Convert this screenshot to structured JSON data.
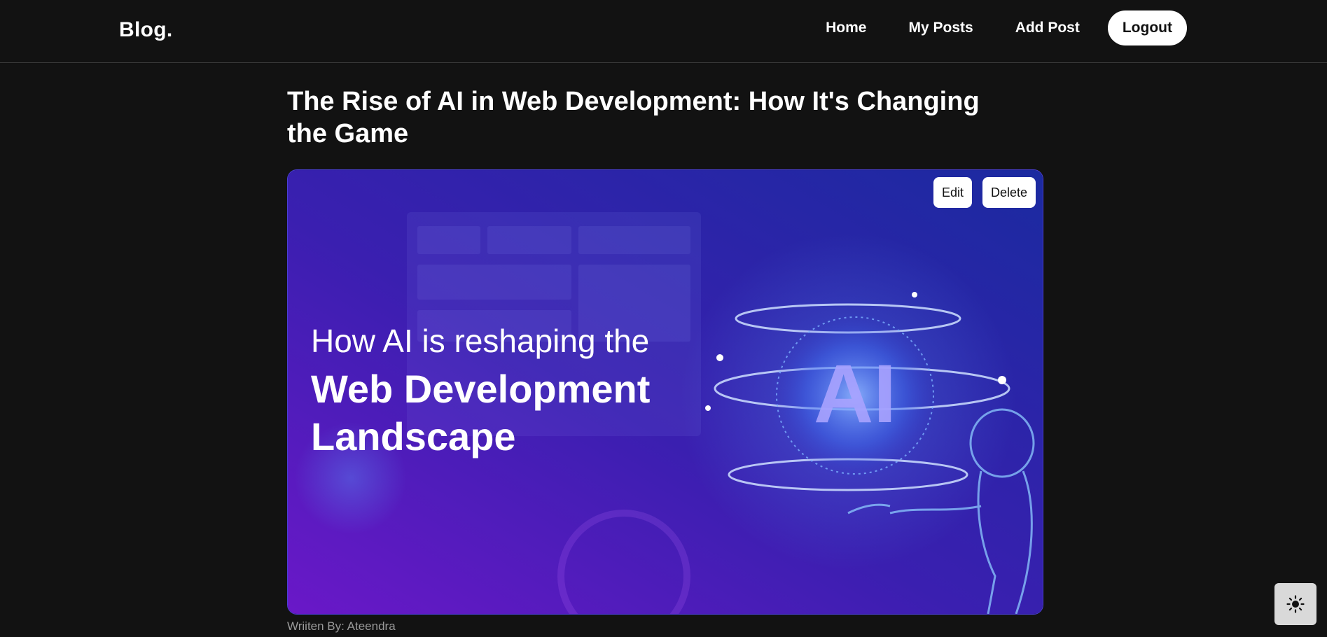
{
  "nav": {
    "logo": "Blog.",
    "links": [
      "Home",
      "My Posts",
      "Add Post"
    ],
    "logout_label": "Logout"
  },
  "post": {
    "title": "The Rise of AI in Web Development: How It's Changing the Game",
    "image": {
      "line1": "How AI is reshaping the",
      "line2": "Web Development",
      "line3": "Landscape",
      "badge": "AI"
    },
    "actions": {
      "edit_label": "Edit",
      "delete_label": "Delete"
    },
    "author": "Wriiten By: Ateendra"
  },
  "theme_toggle": {
    "icon": "sun-icon"
  },
  "colors": {
    "background": "#121212",
    "accent": "#4a3fd6"
  }
}
